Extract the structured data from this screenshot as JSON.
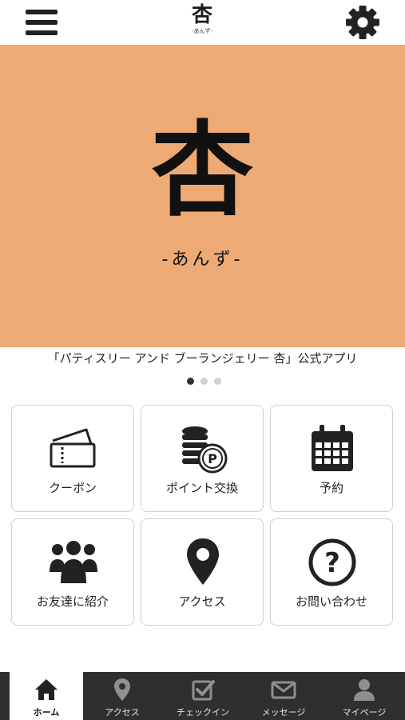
{
  "header": {
    "logo_kanji": "杏",
    "logo_sub": "-あんず-",
    "menu_icon": "hamburger-icon",
    "settings_icon": "gear-icon"
  },
  "hero": {
    "kanji": "杏",
    "subtitle": "-あんず-",
    "background_color": "#eeaa75"
  },
  "caption": "「パティスリー アンド ブーランジェリー 杏」公式アプリ",
  "carousel": {
    "count": 3,
    "active_index": 0
  },
  "tiles": [
    {
      "label": "クーポン",
      "icon": "ticket-icon"
    },
    {
      "label": "ポイント交換",
      "icon": "coins-point-icon"
    },
    {
      "label": "予約",
      "icon": "calendar-icon"
    },
    {
      "label": "お友達に紹介",
      "icon": "group-icon"
    },
    {
      "label": "アクセス",
      "icon": "map-pin-icon"
    },
    {
      "label": "お問い合わせ",
      "icon": "question-icon"
    }
  ],
  "tabbar": {
    "active_index": 0,
    "items": [
      {
        "label": "ホーム",
        "icon": "home-icon"
      },
      {
        "label": "アクセス",
        "icon": "map-pin-icon"
      },
      {
        "label": "チェックイン",
        "icon": "checkin-icon"
      },
      {
        "label": "メッセージ",
        "icon": "envelope-icon"
      },
      {
        "label": "マイページ",
        "icon": "user-icon"
      }
    ]
  },
  "colors": {
    "hero_bg": "#eeaa75",
    "tabbar_bg": "#2f2f2f",
    "icon_dark": "#222222"
  }
}
